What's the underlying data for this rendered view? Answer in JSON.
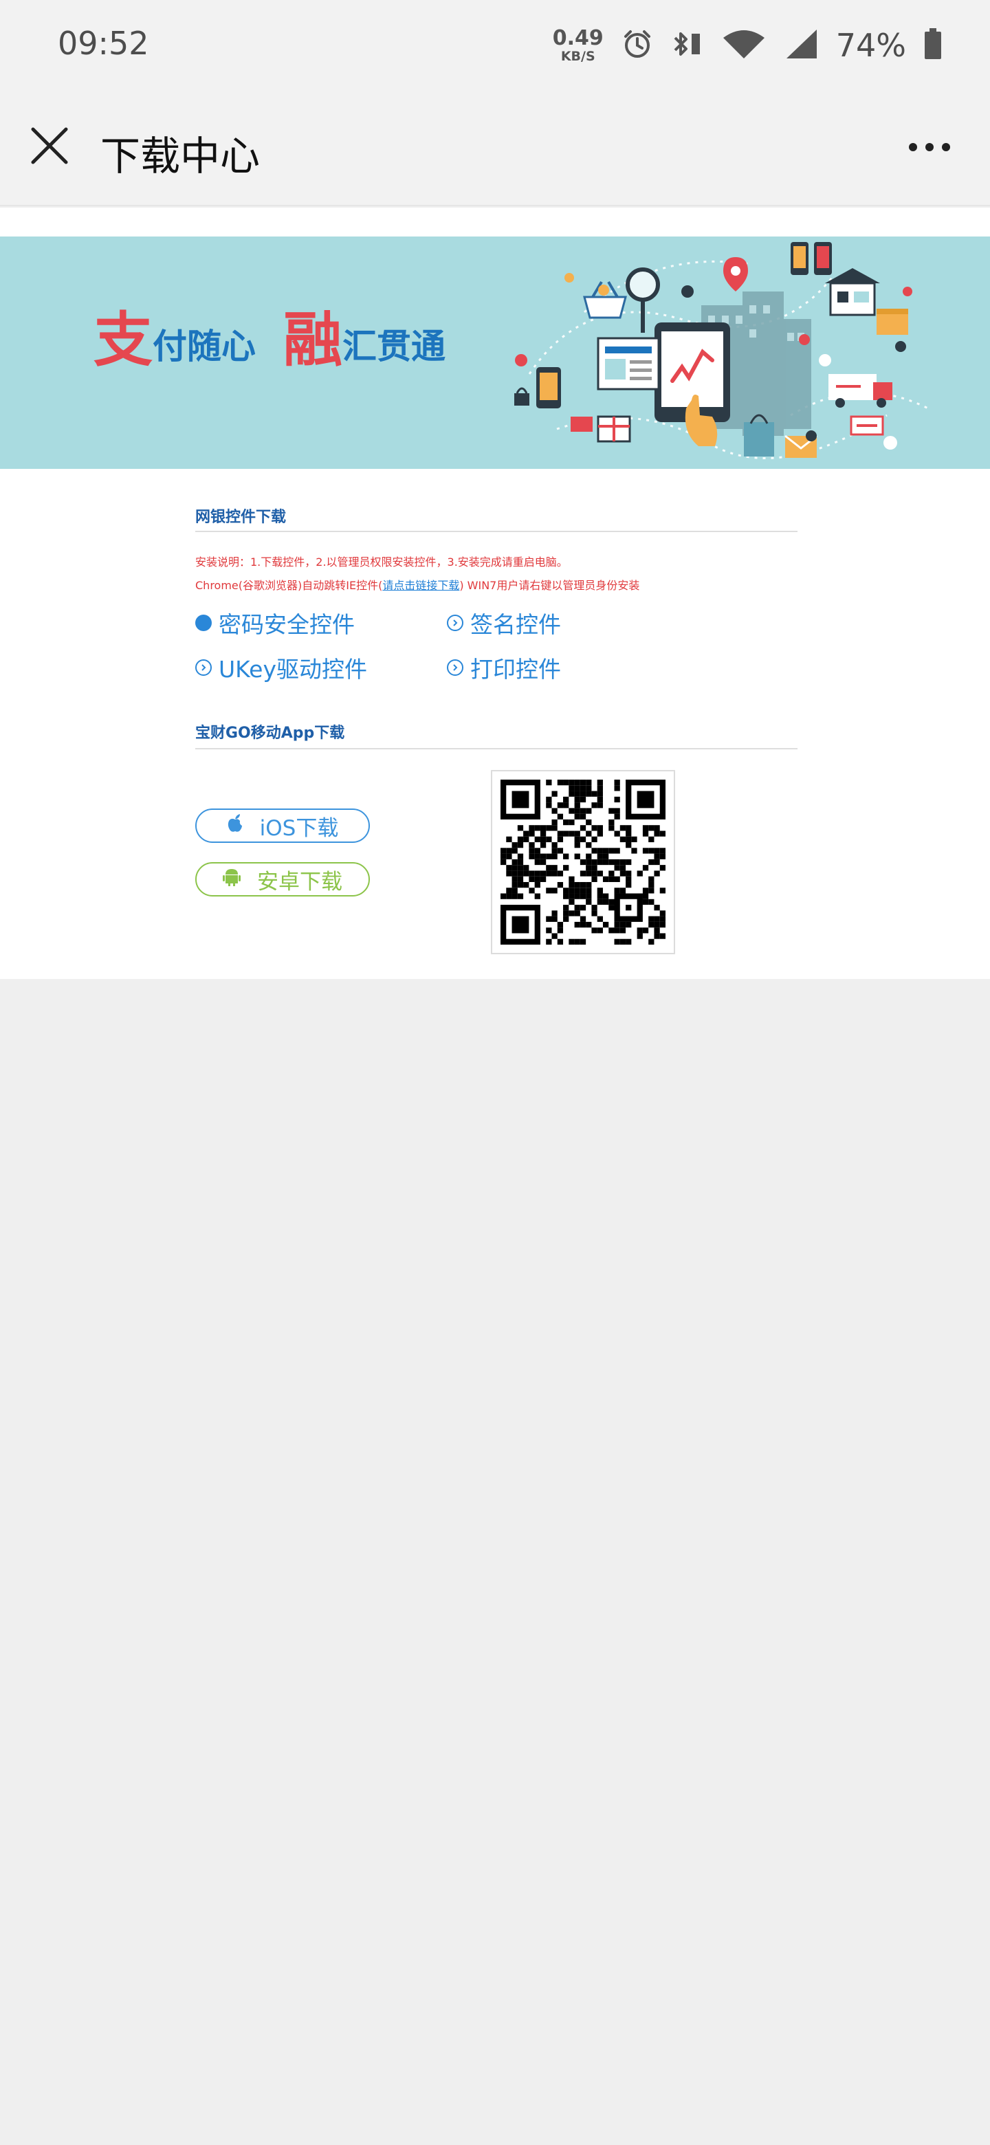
{
  "status_bar": {
    "time": "09:52",
    "net_speed_value": "0.49",
    "net_speed_unit": "KB/S",
    "battery_percent": "74%",
    "icons": [
      "alarm-icon",
      "bluetooth-icon",
      "wifi-icon",
      "cell-signal-icon",
      "battery-icon"
    ]
  },
  "title_bar": {
    "title": "下载中心",
    "close_icon": "close-icon",
    "more_icon": "more-icon"
  },
  "banner": {
    "slogan": [
      {
        "big": "支",
        "small": "付随心"
      },
      {
        "big": "融",
        "small": "汇贯通"
      }
    ],
    "colors": {
      "background": "#a9dbe0",
      "accent_red": "#e5474f",
      "accent_blue": "#1c74bd"
    }
  },
  "bank_controls": {
    "section_title": "网银控件下载",
    "note_line1": "安装说明：1.下载控件，2.以管理员权限安装控件，3.安装完成请重启电脑。",
    "note_line2_prefix": "Chrome(谷歌浏览器)自动跳转IE控件(",
    "note_line2_link": "请点击链接下载",
    "note_line2_suffix": ") WIN7用户请右键以管理员身份安装",
    "links": [
      {
        "label": "密码安全控件",
        "selected": true
      },
      {
        "label": "签名控件",
        "selected": false
      },
      {
        "label": "UKey驱动控件",
        "selected": false
      },
      {
        "label": "打印控件",
        "selected": false
      }
    ]
  },
  "mobile_app": {
    "section_title": "宝财GO移动App下载",
    "ios_button": "iOS下载",
    "android_button": "安卓下载",
    "qr_icon": "qr-code"
  }
}
